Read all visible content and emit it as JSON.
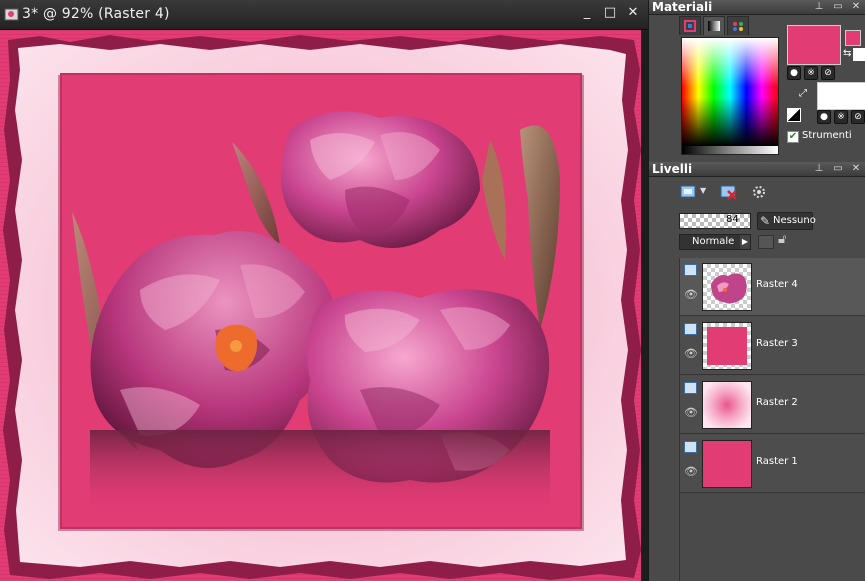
{
  "document": {
    "title": "3* @  92% (Raster 4)",
    "controls": {
      "minimize": "_",
      "maximize": "□",
      "close": "✕"
    }
  },
  "materials": {
    "title": "Materiali",
    "tabs": [
      "frame-tab",
      "gradient-tab",
      "pattern-tab"
    ],
    "foreground_color": "#e23c75",
    "background_color": "#ffffff",
    "strumenti_label": "Strumenti",
    "strumenti_checked": true
  },
  "layers": {
    "title": "Livelli",
    "opacity": "84",
    "mask_label": "Nessuno",
    "blend_mode": "Normale",
    "items": [
      {
        "name": "Raster 4",
        "selected": true,
        "thumb": "flowers"
      },
      {
        "name": "Raster 3",
        "selected": false,
        "thumb": "pink-frame"
      },
      {
        "name": "Raster 2",
        "selected": false,
        "thumb": "pink-glow"
      },
      {
        "name": "Raster 1",
        "selected": false,
        "thumb": "pink-fill"
      }
    ]
  },
  "colors": {
    "canvas_pink": "#e23c75",
    "frame_light": "#fcd6e3",
    "frame_dark": "#8e1d48",
    "panel_bg": "#4a4a4a"
  }
}
